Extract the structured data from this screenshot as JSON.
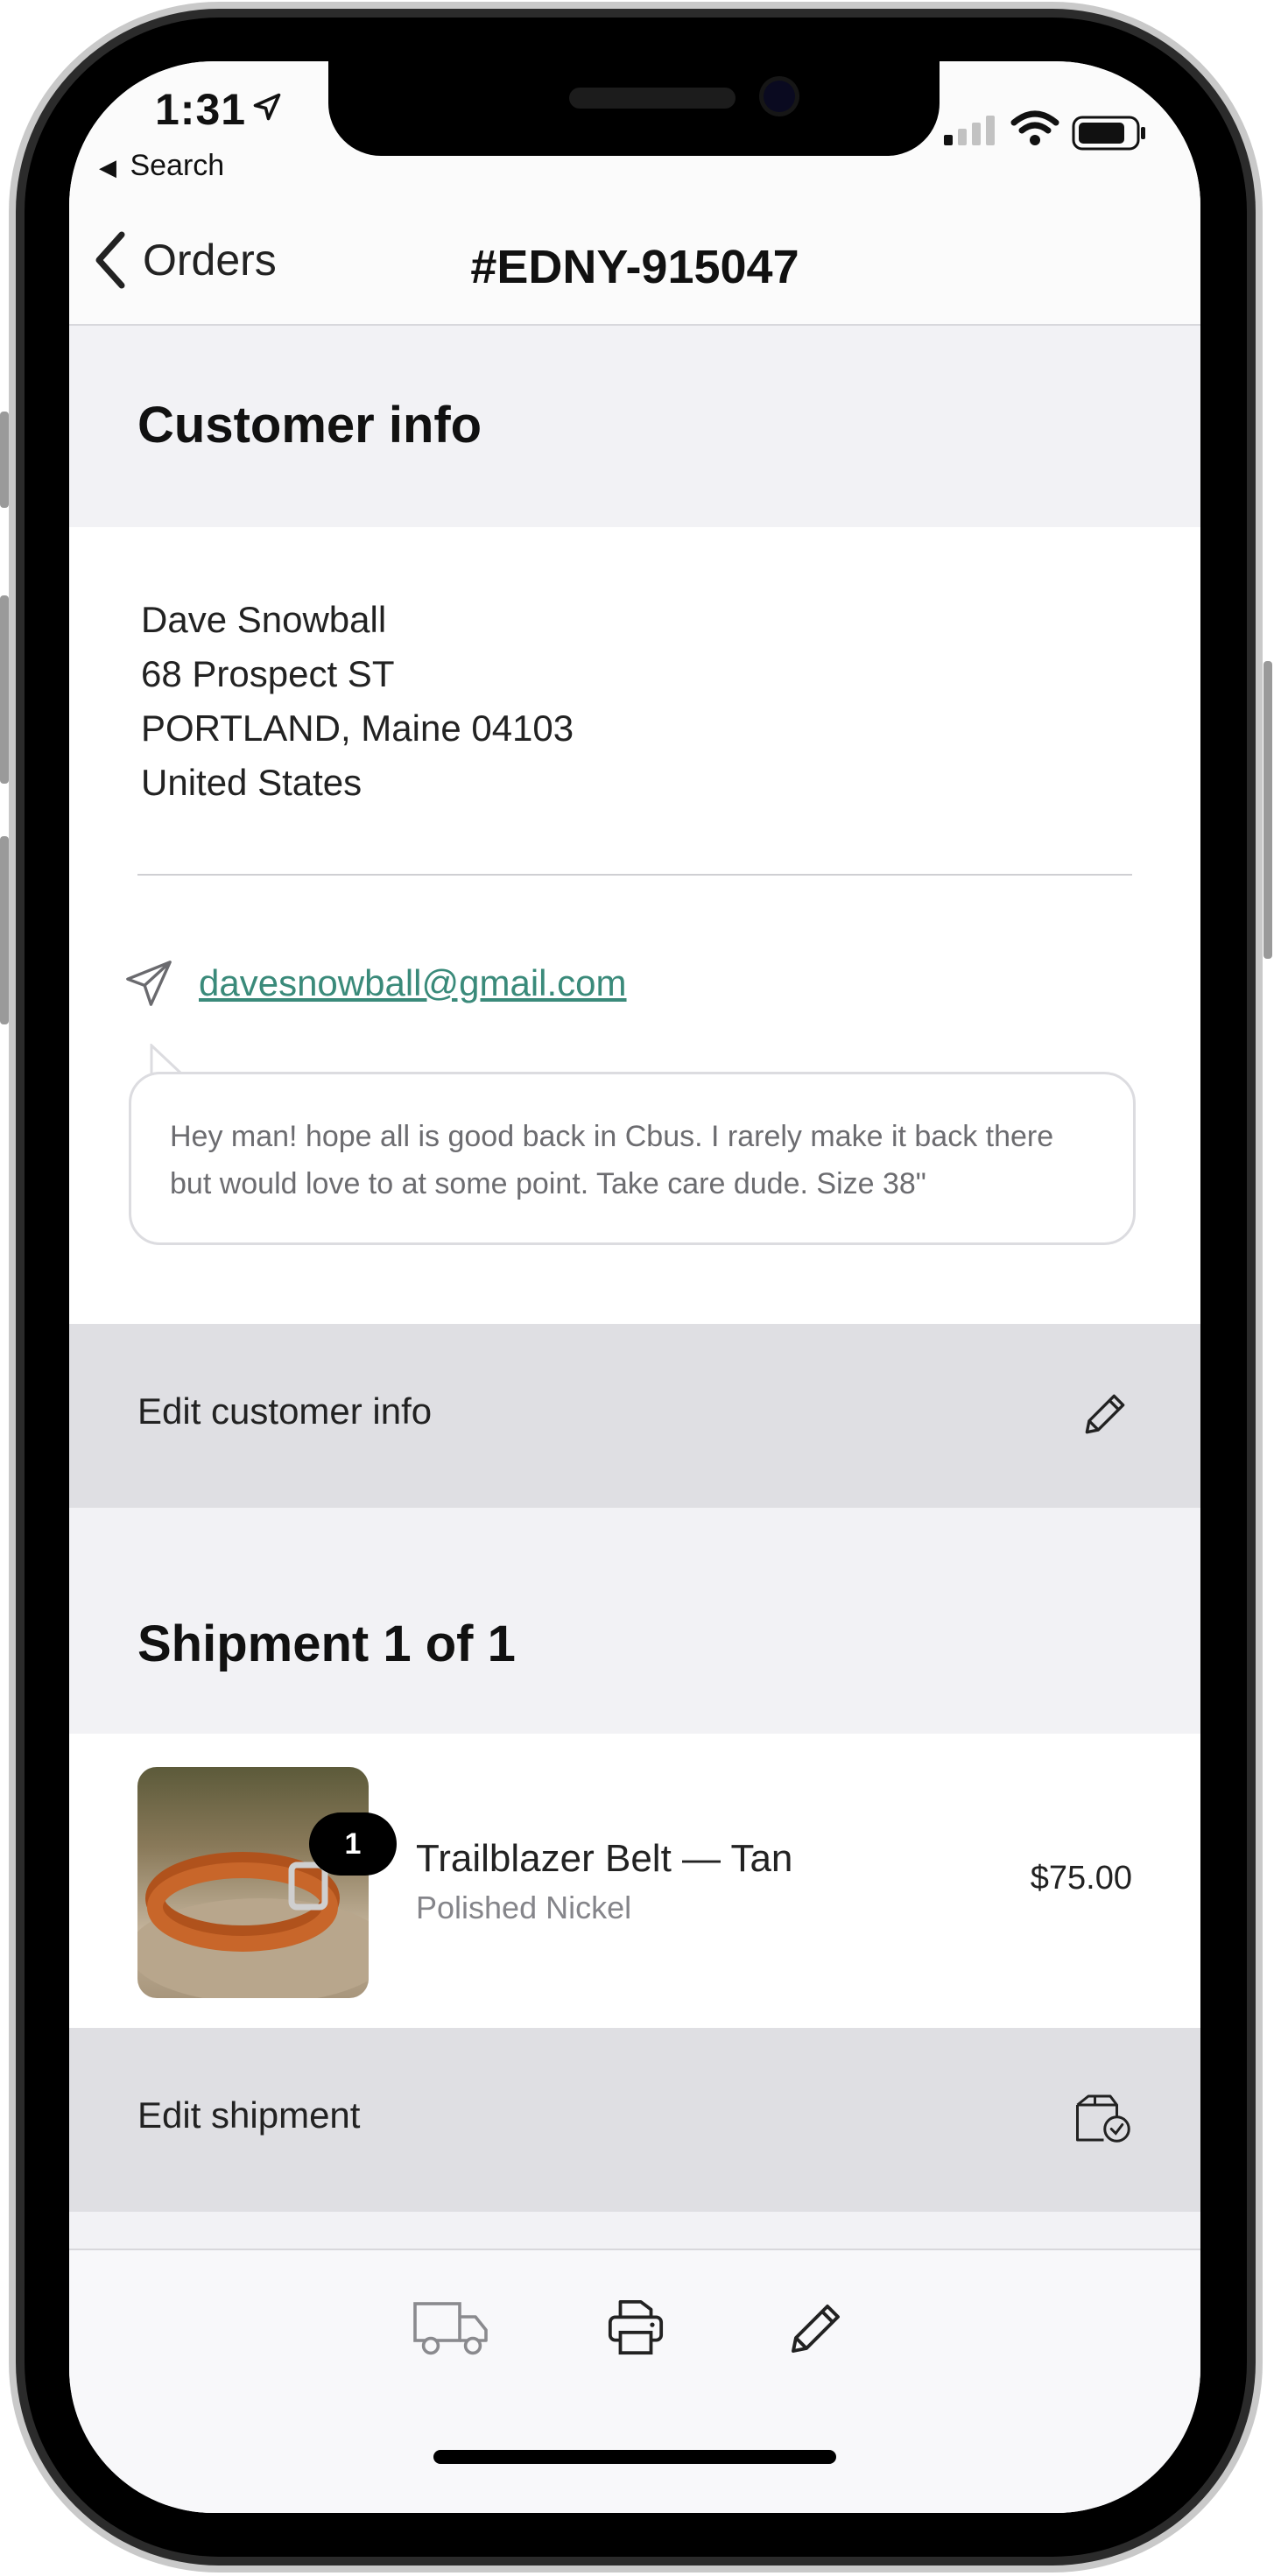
{
  "status_bar": {
    "time": "1:31",
    "back_app": "Search"
  },
  "nav": {
    "back_label": "Orders",
    "title": "#EDNY-915047"
  },
  "customer": {
    "section_title": "Customer info",
    "address_lines": [
      "Dave Snowball",
      "68 Prospect ST",
      "PORTLAND, Maine 04103",
      "United States"
    ],
    "email": "davesnowball@gmail.com",
    "note": "Hey man! hope all is good back in Cbus. I rarely make it back there but would love to at some point. Take care dude.  Size 38\"",
    "edit_label": "Edit customer info"
  },
  "shipment": {
    "section_title": "Shipment 1 of 1",
    "item": {
      "quantity": "1",
      "name": "Trailblazer Belt — Tan",
      "variant": "Polished Nickel",
      "price": "$75.00"
    },
    "edit_label": "Edit shipment"
  },
  "tabbar": {
    "icons": [
      "truck-icon",
      "printer-icon",
      "pencil-icon"
    ]
  },
  "colors": {
    "link": "#3a8a7a",
    "section_bg": "#f2f2f5",
    "action_bg": "#dfdfe3"
  }
}
